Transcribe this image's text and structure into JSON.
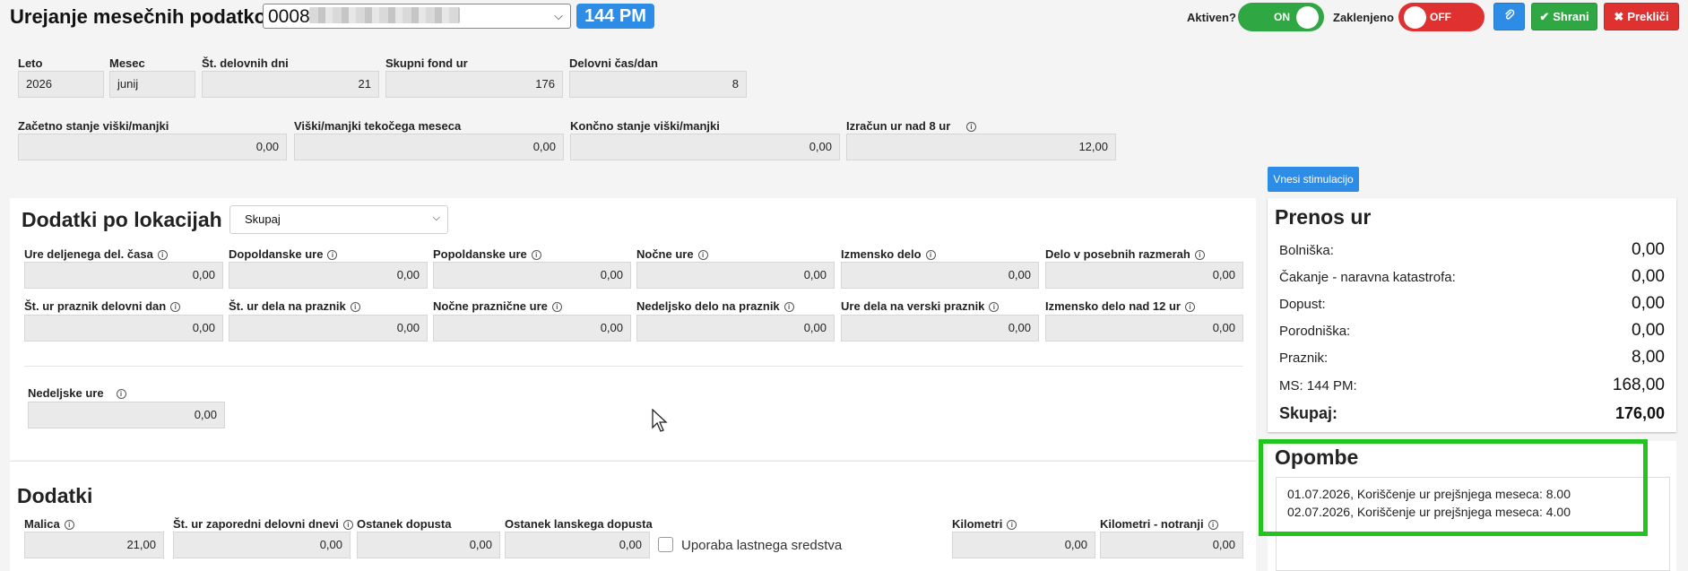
{
  "header": {
    "title": "Urejanje mesečnih podatkov za",
    "employee_id": "0008",
    "plan_badge": "144 PM",
    "active_label": "Aktiven?",
    "active_toggle": "ON",
    "locked_label": "Zaklenjeno",
    "locked_toggle": "OFF",
    "save_label": "Shrani",
    "cancel_label": "Prekliči"
  },
  "colors": {
    "green": "#2fa843",
    "red": "#e03131",
    "blue": "#2c8ce6",
    "highlight": "#22c41e"
  },
  "summary": {
    "row1": [
      {
        "label": "Leto",
        "value": "2026"
      },
      {
        "label": "Mesec",
        "value": "junij"
      },
      {
        "label": "Št. delovnih dni",
        "value": "21"
      },
      {
        "label": "Skupni fond ur",
        "value": "176"
      },
      {
        "label": "Delovni čas/dan",
        "value": "8"
      }
    ],
    "row2": [
      {
        "label": "Začetno stanje viški/manjki",
        "value": "0,00"
      },
      {
        "label": "Viški/manjki tekočega meseca",
        "value": "0,00"
      },
      {
        "label": "Končno stanje viški/manjki",
        "value": "0,00"
      },
      {
        "label": "Izračun ur nad 8 ur",
        "value": "12,00"
      }
    ]
  },
  "stimulation_button": "Vnesi stimulacijo",
  "locations": {
    "title": "Dodatki po lokacijah",
    "select_value": "Skupaj",
    "row1": [
      {
        "label": "Ure deljenega del. časa",
        "value": "0,00"
      },
      {
        "label": "Dopoldanske ure",
        "value": "0,00"
      },
      {
        "label": "Popoldanske ure",
        "value": "0,00"
      },
      {
        "label": "Nočne ure",
        "value": "0,00"
      },
      {
        "label": "Izmensko delo",
        "value": "0,00"
      },
      {
        "label": "Delo v posebnih razmerah",
        "value": "0,00"
      }
    ],
    "row2": [
      {
        "label": "Št. ur praznik delovni dan",
        "value": "0,00"
      },
      {
        "label": "Št. ur dela na praznik",
        "value": "0,00"
      },
      {
        "label": "Nočne praznične ure",
        "value": "0,00"
      },
      {
        "label": "Nedeljsko delo na praznik",
        "value": "0,00"
      },
      {
        "label": "Ure dela na verski praznik",
        "value": "0,00"
      },
      {
        "label": "Izmensko delo nad 12 ur",
        "value": "0,00"
      }
    ],
    "sunday": {
      "label": "Nedeljske ure",
      "value": "0,00"
    }
  },
  "dodatki": {
    "title": "Dodatki",
    "fields": [
      {
        "label": "Malica",
        "value": "21,00"
      },
      {
        "label": "Št. ur zaporedni delovni dnevi",
        "value": "0,00"
      },
      {
        "label": "Ostanek dopusta",
        "value": "0,00"
      },
      {
        "label": "Ostanek lanskega dopusta",
        "value": "0,00"
      }
    ],
    "checkbox_label": "Uporaba lastnega sredstva",
    "km": {
      "label": "Kilometri",
      "value": "0,00"
    },
    "km_internal": {
      "label": "Kilometri - notranji",
      "value": "0,00"
    }
  },
  "prenos": {
    "title": "Prenos ur",
    "rows": [
      {
        "label": "Bolniška:",
        "value": "0,00"
      },
      {
        "label": "Čakanje - naravna katastrofa:",
        "value": "0,00"
      },
      {
        "label": "Dopust:",
        "value": "0,00"
      },
      {
        "label": "Porodniška:",
        "value": "0,00"
      },
      {
        "label": "Praznik:",
        "value": "8,00"
      },
      {
        "label": "MS: 144 PM:",
        "value": "168,00"
      }
    ],
    "total": {
      "label": "Skupaj:",
      "value": "176,00"
    }
  },
  "notes": {
    "title": "Opombe",
    "lines": [
      "01.07.2026, Koriščenje ur prejšnjega meseca: 8.00",
      "02.07.2026, Koriščenje ur prejšnjega meseca: 4.00"
    ]
  }
}
